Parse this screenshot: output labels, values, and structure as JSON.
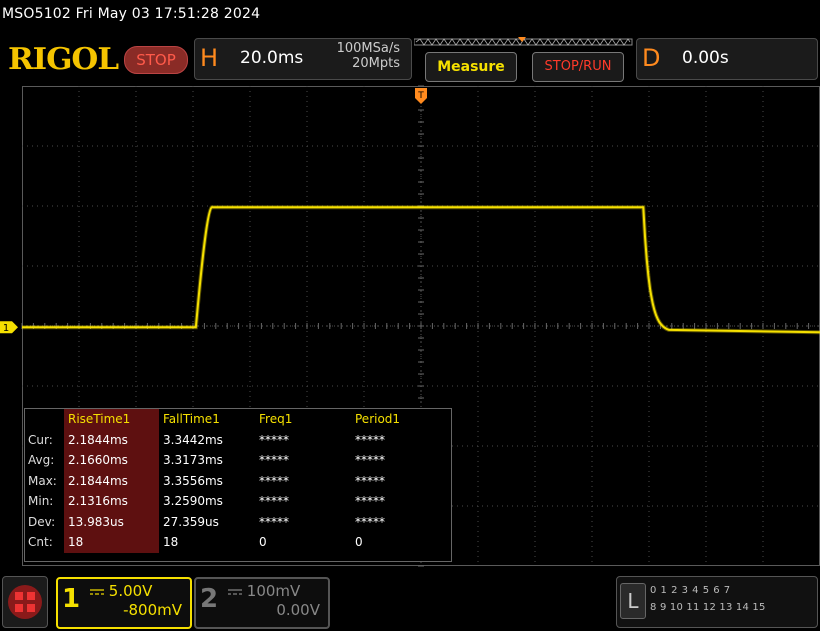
{
  "header": {
    "status_line": "MSO5102  Fri May 03 17:51:28 2024",
    "logo_text": "RIGOL",
    "run_state": "STOP",
    "horizontal": {
      "letter": "H",
      "timebase": "20.0ms",
      "sample_rate": "100MSa/s",
      "memory_depth": "20Mpts"
    },
    "measure_label": "Measure",
    "stop_run_label": "STOP/RUN",
    "delay": {
      "letter": "D",
      "value": "0.00s"
    }
  },
  "waveform": {
    "channel_marker": "1",
    "trigger_marker": "T",
    "color": "#f5e000",
    "low_level_div": 0,
    "high_level_div": 2,
    "rise_time_div": 0.28,
    "fall_time_div": 0.3,
    "rise_start_div": 3.05,
    "fall_start_div": 10.9,
    "horizontal_divisions": 14,
    "vertical_divisions": 8
  },
  "measurements": {
    "columns": [
      "RiseTime1",
      "FallTime1",
      "Freq1",
      "Period1"
    ],
    "rows": [
      {
        "label": "Cur:",
        "values": [
          "2.1844ms",
          "3.3442ms",
          "*****",
          "*****"
        ]
      },
      {
        "label": "Avg:",
        "values": [
          "2.1660ms",
          "3.3173ms",
          "*****",
          "*****"
        ]
      },
      {
        "label": "Max:",
        "values": [
          "2.1844ms",
          "3.3556ms",
          "*****",
          "*****"
        ]
      },
      {
        "label": "Min:",
        "values": [
          "2.1316ms",
          "3.2590ms",
          "*****",
          "*****"
        ]
      },
      {
        "label": "Dev:",
        "values": [
          "13.983us",
          "27.359us",
          "*****",
          "*****"
        ]
      },
      {
        "label": "Cnt:",
        "values": [
          "18",
          "18",
          "0",
          "0"
        ]
      }
    ]
  },
  "channels": {
    "ch1": {
      "number": "1",
      "scale": "5.00V",
      "offset": "-800mV",
      "coupling_icon": "dc-coupling-icon"
    },
    "ch2": {
      "number": "2",
      "scale": "100mV",
      "offset": "0.00V",
      "coupling_icon": "dc-coupling-icon"
    }
  },
  "logic": {
    "letter": "L",
    "row1": "0 1 2 3  4 5 6 7",
    "row2": "8 9 10 11 12 13 14 15"
  }
}
